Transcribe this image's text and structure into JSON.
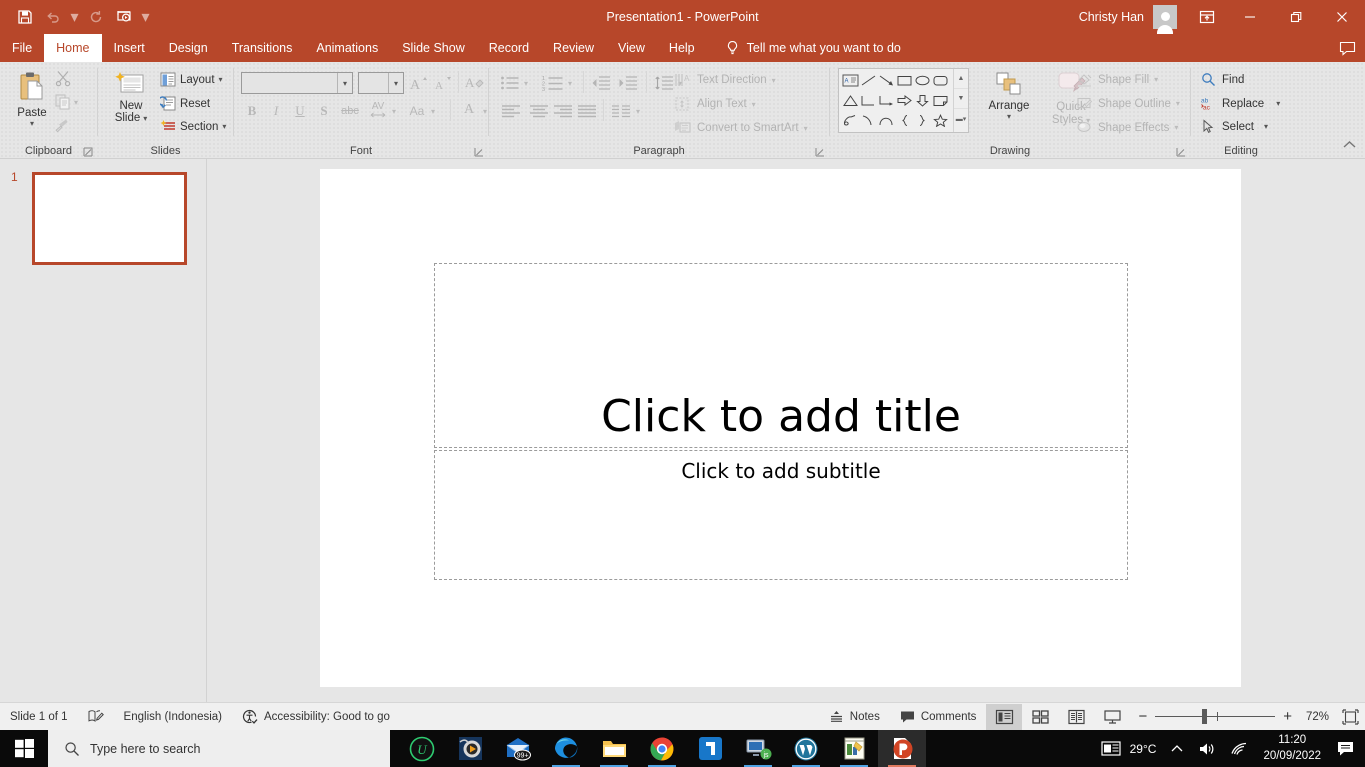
{
  "window": {
    "title": "Presentation1  -  PowerPoint",
    "account_name": "Christy Han",
    "qat": [
      {
        "name": "save",
        "label": "Save",
        "enabled": true
      },
      {
        "name": "undo",
        "label": "Undo",
        "enabled": false
      },
      {
        "name": "redo",
        "label": "Redo",
        "enabled": false
      },
      {
        "name": "start-from-beginning",
        "label": "Start From Beginning",
        "enabled": true
      },
      {
        "name": "customize-quick-access-toolbar",
        "label": "Customize Quick Access Toolbar",
        "enabled": true
      }
    ],
    "controls": {
      "ribbon_display_options": "Ribbon Display Options",
      "minimize": "─",
      "restore": "Restore Down",
      "close": "✕"
    }
  },
  "tabs": [
    {
      "label": "File",
      "active": false
    },
    {
      "label": "Home",
      "active": true
    },
    {
      "label": "Insert",
      "active": false
    },
    {
      "label": "Design",
      "active": false
    },
    {
      "label": "Transitions",
      "active": false
    },
    {
      "label": "Animations",
      "active": false
    },
    {
      "label": "Slide Show",
      "active": false
    },
    {
      "label": "Record",
      "active": false
    },
    {
      "label": "Review",
      "active": false
    },
    {
      "label": "View",
      "active": false
    },
    {
      "label": "Help",
      "active": false
    }
  ],
  "tell_me": {
    "placeholder": "Tell me what you want to do",
    "icon": "lightbulb-icon"
  },
  "ribbon": {
    "collapse_label": "Collapse the Ribbon",
    "groups": [
      {
        "name": "clipboard",
        "label": "Clipboard",
        "items": [
          {
            "label": "Paste",
            "name": "paste-button"
          },
          {
            "label": "Cut",
            "name": "cut-button"
          },
          {
            "label": "Copy",
            "name": "copy-button"
          },
          {
            "label": "Format Painter",
            "name": "format-painter-button"
          }
        ]
      },
      {
        "name": "slides",
        "label": "Slides",
        "items": [
          {
            "label": "New Slide",
            "name": "new-slide-button"
          },
          {
            "label": "Layout",
            "name": "layout-button"
          },
          {
            "label": "Reset",
            "name": "reset-button"
          },
          {
            "label": "Section",
            "name": "section-button"
          }
        ]
      },
      {
        "name": "font",
        "label": "Font",
        "font_name_value": "",
        "font_size_value": "",
        "items": [
          {
            "label": "Increase Font Size",
            "name": "increase-font-size-button"
          },
          {
            "label": "Decrease Font Size",
            "name": "decrease-font-size-button"
          },
          {
            "label": "Clear All Formatting",
            "name": "clear-formatting-button"
          },
          {
            "label": "B",
            "name": "bold-button"
          },
          {
            "label": "I",
            "name": "italic-button"
          },
          {
            "label": "U",
            "name": "underline-button"
          },
          {
            "label": "S",
            "name": "text-shadow-button"
          },
          {
            "label": "abc",
            "name": "strikethrough-button"
          },
          {
            "label": "AV",
            "name": "character-spacing-button"
          },
          {
            "label": "Aa",
            "name": "change-case-button"
          },
          {
            "label": "A",
            "name": "font-color-button"
          }
        ]
      },
      {
        "name": "paragraph",
        "label": "Paragraph",
        "items": [
          {
            "label": "Bullets",
            "name": "bullets-button"
          },
          {
            "label": "Numbering",
            "name": "numbering-button"
          },
          {
            "label": "Decrease Indent",
            "name": "decrease-indent-button"
          },
          {
            "label": "Increase Indent",
            "name": "increase-indent-button"
          },
          {
            "label": "Line Spacing",
            "name": "line-spacing-button"
          },
          {
            "label": "Text Direction",
            "name": "text-direction-button"
          },
          {
            "label": "Align Text",
            "name": "align-text-button"
          },
          {
            "label": "Convert to SmartArt",
            "name": "convert-to-smartart-button"
          },
          {
            "label": "Align Left",
            "name": "align-left-button"
          },
          {
            "label": "Center",
            "name": "align-center-button"
          },
          {
            "label": "Align Right",
            "name": "align-right-button"
          },
          {
            "label": "Justify",
            "name": "justify-button"
          },
          {
            "label": "Columns",
            "name": "columns-button"
          }
        ]
      },
      {
        "name": "drawing",
        "label": "Drawing",
        "items": [
          {
            "label": "Arrange",
            "name": "arrange-button"
          },
          {
            "label": "Quick Styles",
            "name": "quick-styles-button"
          },
          {
            "label": "Shape Fill",
            "name": "shape-fill-button"
          },
          {
            "label": "Shape Outline",
            "name": "shape-outline-button"
          },
          {
            "label": "Shape Effects",
            "name": "shape-effects-button"
          }
        ],
        "shape_gallery": [
          "text-box-shape",
          "line-shape",
          "line-arrow-shape",
          "rectangle-shape",
          "oval-shape",
          "rounded-rectangle-shape",
          "triangle-shape",
          "elbow-connector-shape",
          "elbow-arrow-connector-shape",
          "right-arrow-shape",
          "down-arrow-shape",
          "folded-corner-shape",
          "freeform-scribble-shape",
          "arc-shape",
          "curve-shape",
          "left-brace-shape",
          "right-brace-shape",
          "star-shape"
        ]
      },
      {
        "name": "editing",
        "label": "Editing",
        "items": [
          {
            "label": "Find",
            "name": "find-button"
          },
          {
            "label": "Replace",
            "name": "replace-button"
          },
          {
            "label": "Select",
            "name": "select-button"
          }
        ]
      }
    ]
  },
  "thumbnails": [
    {
      "number": "1",
      "selected": true
    }
  ],
  "slide": {
    "title_placeholder": "Click to add title",
    "subtitle_placeholder": "Click to add subtitle"
  },
  "status_bar": {
    "slide_count": "Slide 1 of 1",
    "notes_icon_label": "Notes page",
    "language": "English (Indonesia)",
    "accessibility": "Accessibility: Good to go",
    "notes": "Notes",
    "comments": "Comments",
    "views": [
      {
        "name": "normal-view-button",
        "label": "Normal",
        "selected": true
      },
      {
        "name": "slide-sorter-view-button",
        "label": "Slide Sorter",
        "selected": false
      },
      {
        "name": "reading-view-button",
        "label": "Reading View",
        "selected": false
      },
      {
        "name": "slide-show-button",
        "label": "Slide Show",
        "selected": false
      }
    ],
    "zoom_out": "−",
    "zoom_in": "+",
    "zoom_level": "72%",
    "fit_label": "Fit slide to current window"
  },
  "taskbar": {
    "search_placeholder": "Type here to search",
    "apps": [
      {
        "name": "iobit-uninstaller-icon",
        "label": "IObit Uninstaller",
        "running": false,
        "badge": ""
      },
      {
        "name": "media-player-icon",
        "label": "Media Player",
        "running": false,
        "badge": ""
      },
      {
        "name": "mail-icon",
        "label": "Mail",
        "running": false,
        "badge": "99+"
      },
      {
        "name": "microsoft-edge-icon",
        "label": "Microsoft Edge",
        "running": true,
        "badge": ""
      },
      {
        "name": "file-explorer-icon",
        "label": "File Explorer",
        "running": true,
        "badge": ""
      },
      {
        "name": "google-chrome-icon",
        "label": "Google Chrome",
        "running": true,
        "badge": ""
      },
      {
        "name": "blue-app-icon",
        "label": "App",
        "running": false,
        "badge": ""
      },
      {
        "name": "remote-desktop-icon",
        "label": "Remote Desktop",
        "running": true,
        "badge": ""
      },
      {
        "name": "wordpress-icon",
        "label": "WordPress",
        "running": true,
        "badge": ""
      },
      {
        "name": "notepad-icon",
        "label": "Notes",
        "running": true,
        "badge": ""
      },
      {
        "name": "powerpoint-icon",
        "label": "PowerPoint",
        "running": true,
        "badge": ""
      }
    ],
    "tray": {
      "news_icon": "news-and-interests-icon",
      "temperature": "29°C",
      "show_hidden_icons": "⌃",
      "volume_icon": "volume-icon",
      "network_icon": "wifi-icon",
      "time": "11:20",
      "date": "20/09/2022",
      "action_center": "notifications-icon"
    }
  },
  "colors": {
    "accent": "#b7472a",
    "ribbon_bg": "#e6e6e6",
    "slide_bg": "#ffffff",
    "taskbar_bg": "#0a0a0a"
  }
}
